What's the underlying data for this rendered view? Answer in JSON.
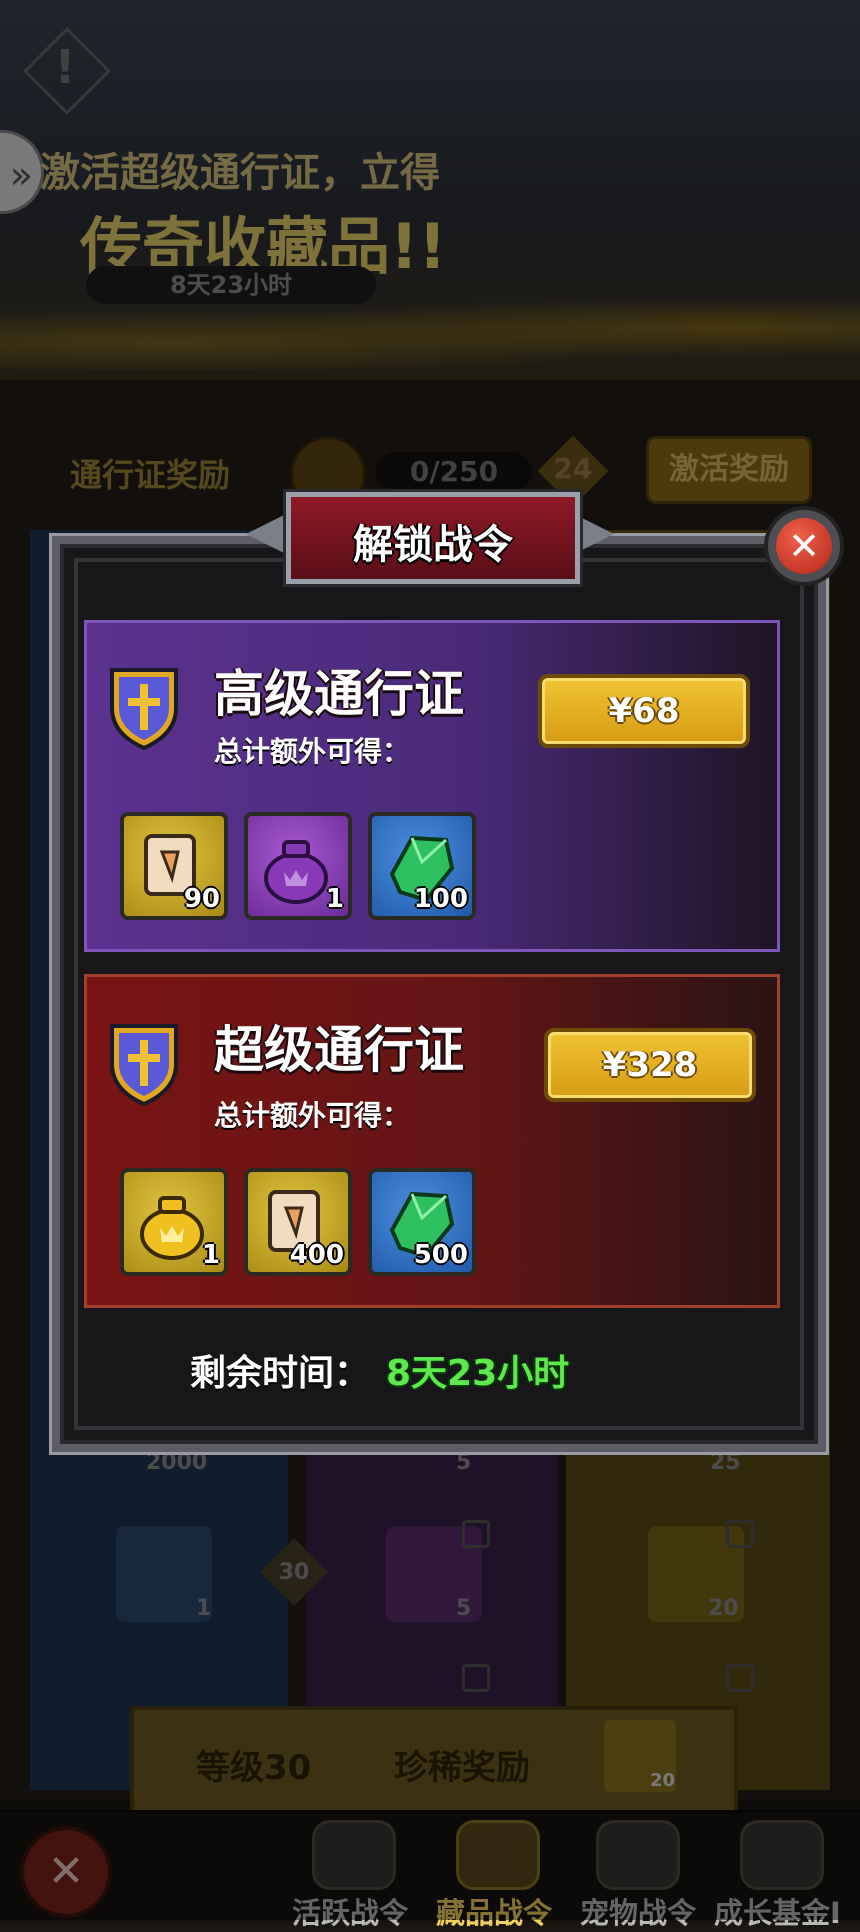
{
  "background": {
    "promo_line1": "激活超级通行证，立得",
    "promo_line2": "传奇收藏品!!",
    "promo_timer": "8天23小时",
    "pass_rewards_label": "通行证奖励",
    "progress": "0/250",
    "level": "24",
    "activate_button": "激活奖励",
    "row_values": [
      "2000",
      "5",
      "25"
    ],
    "row2_level": "30",
    "row2_values": [
      "1",
      "5",
      "20"
    ],
    "banner_level": "等级30",
    "banner_reward": "珍稀奖励",
    "banner_count": "20"
  },
  "bottom_nav": {
    "tabs": [
      "活跃战令",
      "藏品战令",
      "宠物战令",
      "成长基金I"
    ]
  },
  "modal": {
    "title": "解锁战令",
    "close_icon": "close-icon",
    "passes": [
      {
        "name": "高级通行证",
        "subtitle": "总计额外可得：",
        "price": "¥68",
        "items": [
          {
            "icon": "scroll-icon",
            "count": "90"
          },
          {
            "icon": "purple-bag-icon",
            "count": "1"
          },
          {
            "icon": "green-gem-icon",
            "count": "100"
          }
        ]
      },
      {
        "name": "超级通行证",
        "subtitle": "总计额外可得：",
        "price": "¥328",
        "items": [
          {
            "icon": "gold-bag-icon",
            "count": "1"
          },
          {
            "icon": "scroll-icon",
            "count": "400"
          },
          {
            "icon": "green-gem-icon",
            "count": "500"
          }
        ]
      }
    ],
    "remaining_label": "剩余时间：",
    "remaining_value": "8天23小时"
  },
  "colors": {
    "premium_panel": "#5b3290",
    "super_panel": "#7a1414",
    "price_button": "#e6b424",
    "remaining_time": "#5ee84e"
  }
}
